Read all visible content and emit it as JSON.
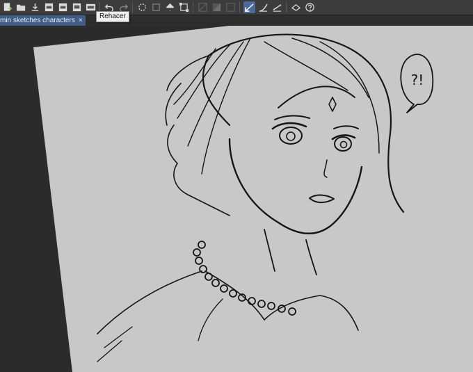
{
  "toolbar": {
    "icons": [
      "new-file-icon",
      "open-folder-icon",
      "save-icon",
      "export-png-icon",
      "export-jpg-icon",
      "print-icon",
      "export-psd-icon",
      "undo-icon",
      "redo-icon",
      "loading-icon",
      "record-icon",
      "fill-icon",
      "transform-icon",
      "select-all-icon",
      "invert-selection-icon",
      "deselect-icon",
      "pen-stabilizer-icon",
      "pen-curve-icon",
      "pen-straight-icon",
      "hat-icon",
      "help-icon"
    ],
    "tooltip": "Rehacer"
  },
  "tabs": [
    {
      "label": "min sketches characters",
      "close": "×"
    }
  ],
  "canvas": {
    "paper_color": "#c8c8c8",
    "speech_bubble_text": "?!"
  },
  "colors": {
    "toolbar_bg": "#3c3c3c",
    "tab_active": "#3f5d86",
    "workspace": "#2b2b2b",
    "active_tool": "#4a6a9a"
  }
}
